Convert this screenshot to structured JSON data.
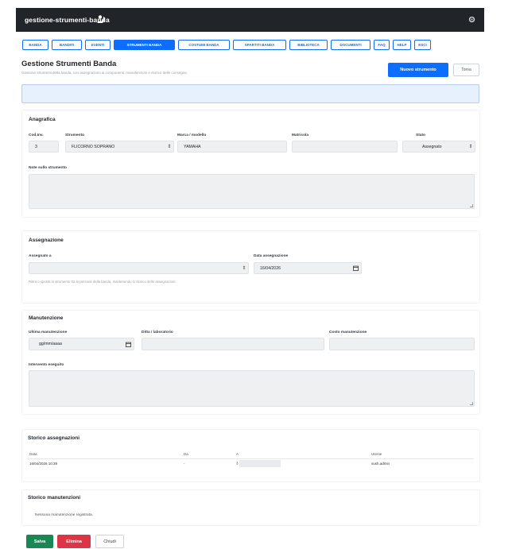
{
  "app": {
    "brand": "gestione-strumenti-banda",
    "user_icon": "user-music-icon",
    "settings_icon": "gear-icon"
  },
  "nav": {
    "tabs": [
      {
        "label": "BANDA"
      },
      {
        "label": "BANDITI"
      },
      {
        "label": "EVENTI"
      },
      {
        "label": "STRUMENTI BANDA",
        "active": true
      },
      {
        "label": "COSTUMI BANDA"
      },
      {
        "label": "SPARTITI BANDA"
      },
      {
        "label": "BIBLIOTECA"
      },
      {
        "label": "DOCUMENTI"
      },
      {
        "label": "FAQ"
      },
      {
        "label": "HELP"
      },
      {
        "label": "ESCI"
      }
    ]
  },
  "header": {
    "title": "Gestione Strumenti Banda",
    "subtitle": "Gestione strumenti della banda, con assegnazioni ai componenti, manutenzioni e storico delle consegne.",
    "new_button": "Nuovo strumento",
    "back_button": "Torna"
  },
  "anagrafica": {
    "title": "Anagrafica",
    "cod_label": "Cod.Inv.",
    "cod_value": "3",
    "strumento_label": "Strumento",
    "strumento_value": "FLICORNO SOPRANO",
    "marca_label": "Marca / modello",
    "marca_value": "YAMAHA",
    "matricola_label": "Matricola",
    "matricola_value": "",
    "stato_label": "Stato",
    "stato_value": "Assegnato",
    "note_label": "Note sullo strumento"
  },
  "assegnazione": {
    "title": "Assegnazione",
    "assegnato_label": "Assegnato a",
    "assegnato_value": "",
    "data_label": "Data assegnazione",
    "data_value": "16/04/2026",
    "hint": "Ritira o sposta lo strumento tra le persone della banda, mantenendo lo storico delle assegnazioni."
  },
  "manutenzione": {
    "title": "Manutenzione",
    "ultima_label": "Ultima manutenzione",
    "ultima_value": "gg/mm/aaaa",
    "ditta_label": "Ditta / laboratorio",
    "costo_label": "Costo manutenzione",
    "intervento_label": "Intervento eseguito"
  },
  "storico_assegnazioni": {
    "title": "Storico assegnazioni",
    "columns": [
      "Data",
      "Da",
      "A",
      "Utente"
    ],
    "rows": [
      {
        "data": "16/04/2026 10:39",
        "da": "-",
        "a": "3",
        "utente": "sush.admin"
      }
    ]
  },
  "storico_manutenzioni": {
    "title": "Storico manutenzioni",
    "empty": "Nessuna manutenzione registrata."
  },
  "actions": {
    "save": "Salva",
    "delete": "Elimina",
    "close": "Chiudi"
  },
  "colors": {
    "primary": "#0d6efd",
    "dark": "#212529",
    "success": "#198754",
    "danger": "#dc3545"
  }
}
